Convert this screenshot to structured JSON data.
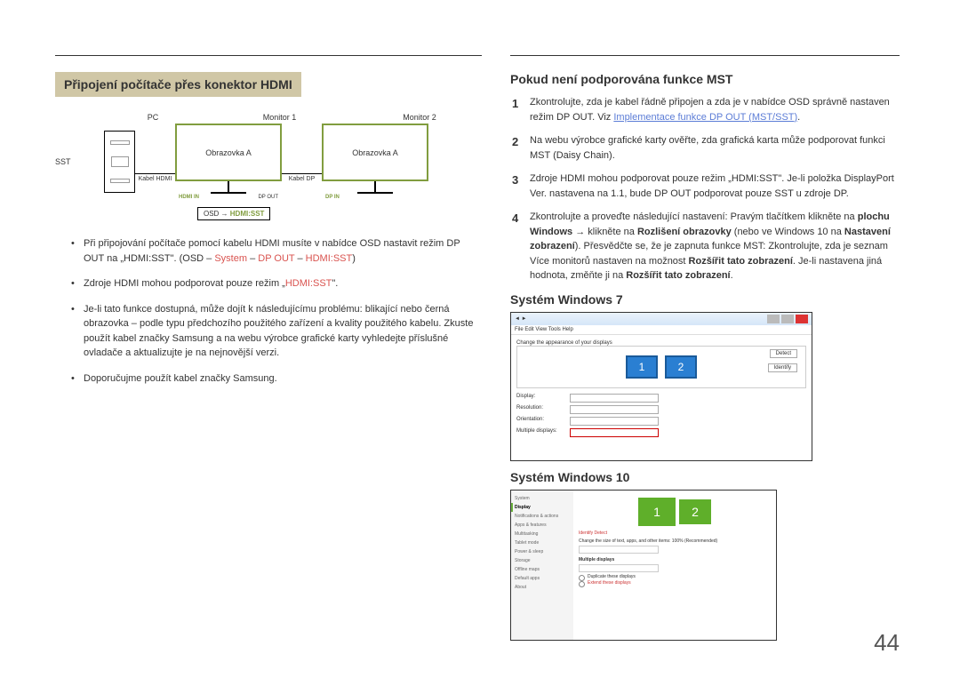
{
  "left": {
    "heading": "Připojení počítače přes konektor HDMI",
    "diagram": {
      "pc": "PC",
      "m1": "Monitor 1",
      "m2": "Monitor 2",
      "sst": "SST",
      "screenA": "Obrazovka A",
      "screenA2": "Obrazovka A",
      "kabelHdmi": "Kabel HDMI",
      "kabelDp": "Kabel DP",
      "hdmiIn": "HDMI IN",
      "dpOut": "DP OUT",
      "dpIn": "DP IN",
      "osdLabel": "OSD → ",
      "osdValue": "HDMI:SST"
    },
    "bullets": [
      {
        "pre": "Při připojování počítače pomocí kabelu HDMI musíte v nabídce OSD nastavit režim DP OUT na „HDMI:SST\". (OSD – ",
        "red1": "System",
        "mid": " – ",
        "red2": "DP OUT",
        "mid2": " – ",
        "red3": "HDMI:SST",
        "post": ")"
      },
      {
        "pre": "Zdroje HDMI mohou podporovat pouze režim „",
        "red1": "HDMI:SST",
        "post": "\"."
      },
      {
        "text": "Je-li tato funkce dostupná, může dojít k následujícímu problému: blikající nebo černá obrazovka – podle typu předchozího použitého zařízení a kvality použitého kabelu. Zkuste použít kabel značky Samsung a na webu výrobce grafické karty vyhledejte příslušné ovladače a aktualizujte je na nejnovější verzi."
      },
      {
        "text": "Doporučujme použít kabel značky Samsung."
      }
    ]
  },
  "right": {
    "heading_mst": "Pokud není podporována funkce MST",
    "steps": [
      {
        "pre": "Zkontrolujte, zda je kabel řádně připojen a zda je v nabídce OSD správně nastaven režim DP OUT. Viz ",
        "link": "Implementace funkce DP OUT (MST/SST)",
        "post": "."
      },
      {
        "text": "Na webu výrobce grafické karty ověřte, zda grafická karta může podporovat funkci MST (Daisy Chain)."
      },
      {
        "text": "Zdroje HDMI mohou podporovat pouze režim „HDMI:SST\". Je-li položka DisplayPort Ver. nastavena na 1.1, bude DP OUT podporovat pouze SST u zdroje DP."
      },
      {
        "pre": "Zkontrolujte a proveďte následující nastavení: Pravým tlačítkem klikněte na ",
        "b1": "plochu Windows",
        "mid1": " → klikněte na ",
        "b2": "Rozlišení obrazovky",
        "mid2": " (nebo ve Windows 10 na ",
        "b3": "Nastavení zobrazení",
        "mid3": "). Přesvědčte se, že je zapnuta funkce MST: Zkontrolujte, zda je seznam Více monitorů nastaven na možnost ",
        "b4": "Rozšířit tato zobrazení",
        "mid4": ". Je-li nastavena jiná hodnota, změňte ji na ",
        "b5": "Rozšířit tato zobrazení",
        "post": "."
      }
    ],
    "win7_heading": "Systém Windows 7",
    "win10_heading": "Systém Windows 10",
    "win7": {
      "title_hint": "Change the appearance of your displays",
      "detect": "Detect",
      "identify": "Identify",
      "labels": {
        "display": "Display:",
        "resolution": "Resolution:",
        "orientation": "Orientation:",
        "multi": "Multiple displays:"
      }
    },
    "win10": {
      "side": [
        "System",
        "Display",
        "Notifications & actions",
        "Apps & features",
        "Multitasking",
        "Tablet mode",
        "Power & sleep",
        "Storage",
        "Offline maps",
        "Default apps",
        "About"
      ],
      "preview_line": "Change the size of text, apps, and other items: 100% (Recommended)",
      "multi_label": "Multiple displays",
      "radio1": "Duplicate these displays",
      "radio2": "Extend these displays"
    }
  },
  "page_number": "44"
}
